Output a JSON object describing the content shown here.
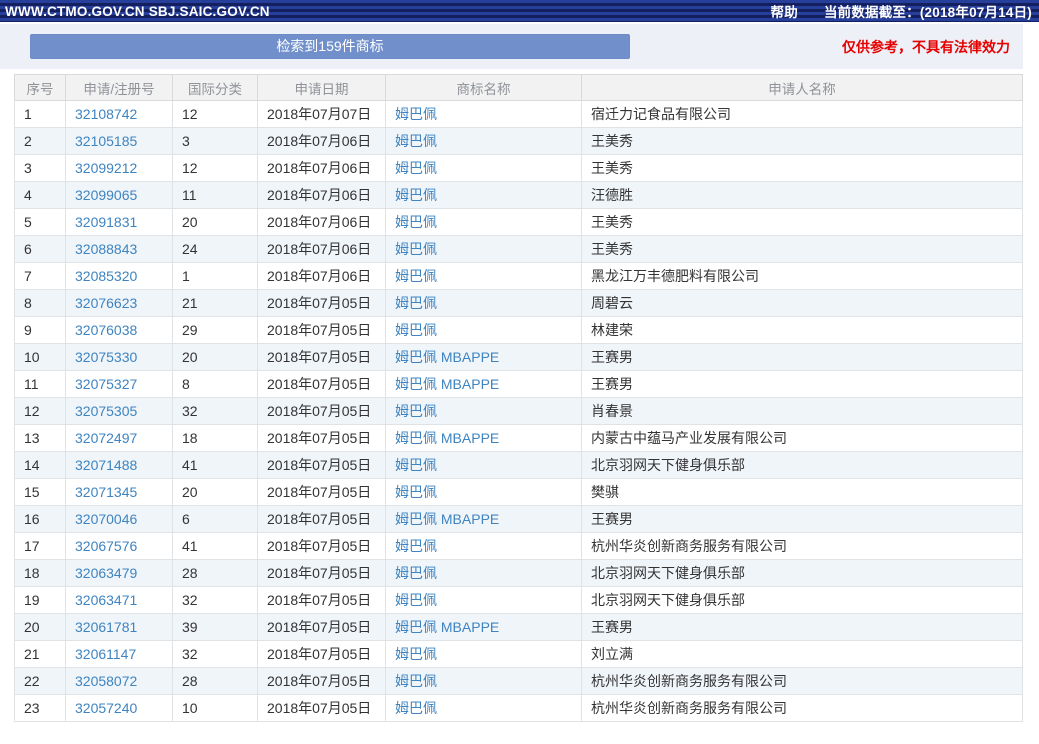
{
  "topbar": {
    "site_title": "WWW.CTMO.GOV.CN SBJ.SAIC.GOV.CN",
    "help_label": "帮助",
    "data_cutoff": "当前数据截至：(2018年07月14日)"
  },
  "notice": {
    "result_button": "检索到159件商标",
    "result_count": 159,
    "disclaimer": "仅供参考，不具有法律效力"
  },
  "colors": {
    "topbar_stripe_dark": "#141f60",
    "topbar_stripe_light": "#253f9b",
    "button_bg": "#7190cb",
    "disclaimer_red": "#e60000",
    "link_blue": "#3e84c0",
    "row_alt_bg": "#f0f5fa",
    "header_bg": "#f2f2f2",
    "border": "#d9d9d9"
  },
  "table": {
    "columns": [
      "序号",
      "申请/注册号",
      "国际分类",
      "申请日期",
      "商标名称",
      "申请人名称"
    ],
    "rows": [
      {
        "no": "1",
        "reg_no": "32108742",
        "intl_class": "12",
        "date": "2018年07月07日",
        "mark": "姆巴佩",
        "applicant": "宿迁力记食品有限公司"
      },
      {
        "no": "2",
        "reg_no": "32105185",
        "intl_class": "3",
        "date": "2018年07月06日",
        "mark": "姆巴佩",
        "applicant": "王美秀"
      },
      {
        "no": "3",
        "reg_no": "32099212",
        "intl_class": "12",
        "date": "2018年07月06日",
        "mark": "姆巴佩",
        "applicant": "王美秀"
      },
      {
        "no": "4",
        "reg_no": "32099065",
        "intl_class": "11",
        "date": "2018年07月06日",
        "mark": "姆巴佩",
        "applicant": "汪德胜"
      },
      {
        "no": "5",
        "reg_no": "32091831",
        "intl_class": "20",
        "date": "2018年07月06日",
        "mark": "姆巴佩",
        "applicant": "王美秀"
      },
      {
        "no": "6",
        "reg_no": "32088843",
        "intl_class": "24",
        "date": "2018年07月06日",
        "mark": "姆巴佩",
        "applicant": "王美秀"
      },
      {
        "no": "7",
        "reg_no": "32085320",
        "intl_class": "1",
        "date": "2018年07月06日",
        "mark": "姆巴佩",
        "applicant": "黑龙江万丰德肥料有限公司"
      },
      {
        "no": "8",
        "reg_no": "32076623",
        "intl_class": "21",
        "date": "2018年07月05日",
        "mark": "姆巴佩",
        "applicant": "周碧云"
      },
      {
        "no": "9",
        "reg_no": "32076038",
        "intl_class": "29",
        "date": "2018年07月05日",
        "mark": "姆巴佩",
        "applicant": "林建荣"
      },
      {
        "no": "10",
        "reg_no": "32075330",
        "intl_class": "20",
        "date": "2018年07月05日",
        "mark": "姆巴佩 MBAPPE",
        "applicant": "王赛男"
      },
      {
        "no": "11",
        "reg_no": "32075327",
        "intl_class": "8",
        "date": "2018年07月05日",
        "mark": "姆巴佩 MBAPPE",
        "applicant": "王赛男"
      },
      {
        "no": "12",
        "reg_no": "32075305",
        "intl_class": "32",
        "date": "2018年07月05日",
        "mark": "姆巴佩",
        "applicant": "肖春景"
      },
      {
        "no": "13",
        "reg_no": "32072497",
        "intl_class": "18",
        "date": "2018年07月05日",
        "mark": "姆巴佩 MBAPPE",
        "applicant": "内蒙古中蕴马产业发展有限公司"
      },
      {
        "no": "14",
        "reg_no": "32071488",
        "intl_class": "41",
        "date": "2018年07月05日",
        "mark": "姆巴佩",
        "applicant": "北京羽网天下健身俱乐部"
      },
      {
        "no": "15",
        "reg_no": "32071345",
        "intl_class": "20",
        "date": "2018年07月05日",
        "mark": "姆巴佩",
        "applicant": "樊骐"
      },
      {
        "no": "16",
        "reg_no": "32070046",
        "intl_class": "6",
        "date": "2018年07月05日",
        "mark": "姆巴佩 MBAPPE",
        "applicant": "王赛男"
      },
      {
        "no": "17",
        "reg_no": "32067576",
        "intl_class": "41",
        "date": "2018年07月05日",
        "mark": "姆巴佩",
        "applicant": "杭州华炎创新商务服务有限公司"
      },
      {
        "no": "18",
        "reg_no": "32063479",
        "intl_class": "28",
        "date": "2018年07月05日",
        "mark": "姆巴佩",
        "applicant": "北京羽网天下健身俱乐部"
      },
      {
        "no": "19",
        "reg_no": "32063471",
        "intl_class": "32",
        "date": "2018年07月05日",
        "mark": "姆巴佩",
        "applicant": "北京羽网天下健身俱乐部"
      },
      {
        "no": "20",
        "reg_no": "32061781",
        "intl_class": "39",
        "date": "2018年07月05日",
        "mark": "姆巴佩 MBAPPE",
        "applicant": "王赛男"
      },
      {
        "no": "21",
        "reg_no": "32061147",
        "intl_class": "32",
        "date": "2018年07月05日",
        "mark": "姆巴佩",
        "applicant": "刘立满"
      },
      {
        "no": "22",
        "reg_no": "32058072",
        "intl_class": "28",
        "date": "2018年07月05日",
        "mark": "姆巴佩",
        "applicant": "杭州华炎创新商务服务有限公司"
      },
      {
        "no": "23",
        "reg_no": "32057240",
        "intl_class": "10",
        "date": "2018年07月05日",
        "mark": "姆巴佩",
        "applicant": "杭州华炎创新商务服务有限公司"
      }
    ]
  }
}
